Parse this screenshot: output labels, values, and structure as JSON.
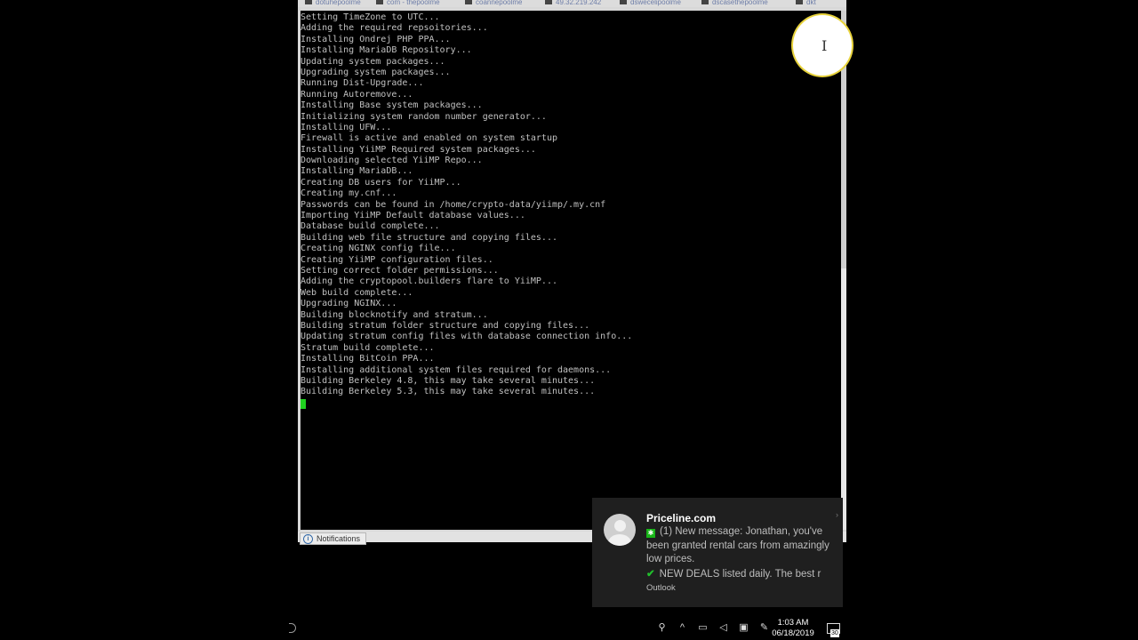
{
  "tabs": [
    {
      "label": "dotuhepoolme"
    },
    {
      "label": "com - thepoolme"
    },
    {
      "label": "coannepoolme"
    },
    {
      "label": "49.32.219.242"
    },
    {
      "label": "dswecelipoolme"
    },
    {
      "label": "dscasethepoolme"
    },
    {
      "label": "dkt"
    }
  ],
  "terminal": {
    "lines": [
      "Setting TimeZone to UTC...",
      "Adding the required repsoitories...",
      "Installing Ondrej PHP PPA...",
      "Installing MariaDB Repository...",
      "Updating system packages...",
      "Upgrading system packages...",
      "Running Dist-Upgrade...",
      "Running Autoremove...",
      "Installing Base system packages...",
      "Initializing system random number generator...",
      "Installing UFW...",
      "Firewall is active and enabled on system startup",
      "Installing YiiMP Required system packages...",
      "Downloading selected YiiMP Repo...",
      "Installing MariaDB...",
      "Creating DB users for YiiMP...",
      "Creating my.cnf...",
      "Passwords can be found in /home/crypto-data/yiimp/.my.cnf",
      "Importing YiiMP Default database values...",
      "Database build complete...",
      "Building web file structure and copying files...",
      "Creating NGINX config file...",
      "Creating YiiMP configuration files..",
      "Setting correct folder permissions...",
      "Adding the cryptopool.builders flare to YiiMP...",
      "Web build complete...",
      "Upgrading NGINX...",
      "Building blocknotify and stratum...",
      "Building stratum folder structure and copying files...",
      "Updating stratum config files with database connection info...",
      "Stratum build complete...",
      "Installing BitCoin PPA...",
      "Installing additional system files required for daemons...",
      "Building Berkeley 4.8, this may take several minutes...",
      "Building Berkeley 5.3, this may take several minutes..."
    ]
  },
  "statusbar": {
    "notifications_label": "Notifications"
  },
  "toast": {
    "app": "Priceline.com",
    "message": "(1) New message: Jonathan, you've been granted rental cars from amazingly low prices.",
    "line2": "NEW DEALS listed daily. The best r",
    "source": "Outlook",
    "badge_glyph": "✱",
    "check_glyph": "✔"
  },
  "taskbar": {
    "time": "1:03 AM",
    "date": "06/18/2019",
    "notification_count": "30",
    "tray_icons": [
      {
        "name": "people-icon",
        "glyph": "⚲"
      },
      {
        "name": "chevron-up-icon",
        "glyph": "^"
      },
      {
        "name": "battery-icon",
        "glyph": "▭"
      },
      {
        "name": "speaker-icon",
        "glyph": "◁"
      },
      {
        "name": "network-icon",
        "glyph": "▣"
      },
      {
        "name": "pen-icon",
        "glyph": "✎"
      }
    ]
  },
  "colors": {
    "terminal_text": "#c0c0c0",
    "cursor": "#1fd21f",
    "toast_bg": "#1f1f1f",
    "highlight_ring": "#e8d33c"
  }
}
